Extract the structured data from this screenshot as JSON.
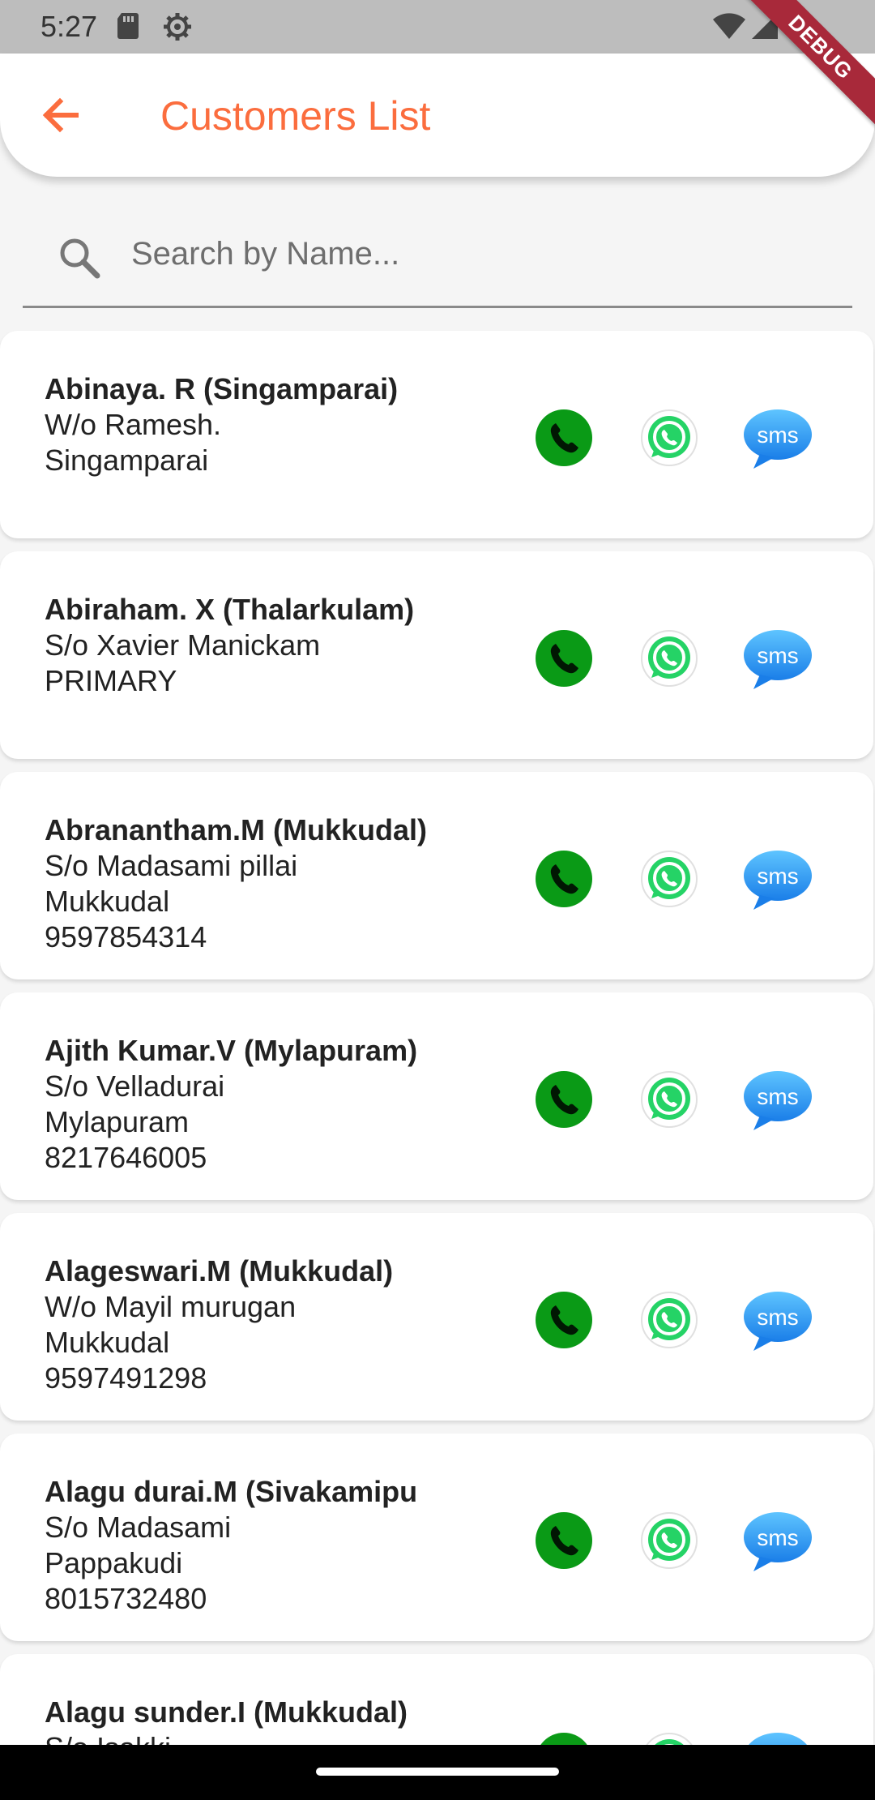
{
  "status_bar": {
    "time": "5:27"
  },
  "debug_banner": "DEBUG",
  "app_bar": {
    "title": "Customers List"
  },
  "search": {
    "placeholder": "Search by Name...",
    "value": ""
  },
  "actions": {
    "sms_label": "sms"
  },
  "customers": [
    {
      "name": "Abinaya. R (Singamparai)",
      "relation": "W/o Ramesh.",
      "place": "Singamparai",
      "phone": ""
    },
    {
      "name": "Abiraham. X (Thalarkulam)",
      "relation": "S/o Xavier Manickam",
      "place": "PRIMARY",
      "phone": ""
    },
    {
      "name": "Abranantham.M (Mukkudal)",
      "relation": "S/o Madasami pillai",
      "place": "Mukkudal",
      "phone": "9597854314"
    },
    {
      "name": "Ajith Kumar.V (Mylapuram)",
      "relation": "S/o Velladurai",
      "place": "Mylapuram",
      "phone": "8217646005"
    },
    {
      "name": "Alageswari.M (Mukkudal)",
      "relation": "W/o Mayil murugan",
      "place": "Mukkudal",
      "phone": "9597491298"
    },
    {
      "name": "Alagu durai.M (Sivakamipu",
      "relation": "S/o Madasami",
      "place": "Pappakudi",
      "phone": "8015732480"
    },
    {
      "name": "Alagu sunder.I (Mukkudal)",
      "relation": "S/o Isakki",
      "place": "",
      "phone": ""
    }
  ],
  "colors": {
    "accent": "#fb6d3e",
    "call_green": "#0a9a16",
    "whatsapp_green": "#25d366",
    "sms_blue": "#2196f3"
  }
}
